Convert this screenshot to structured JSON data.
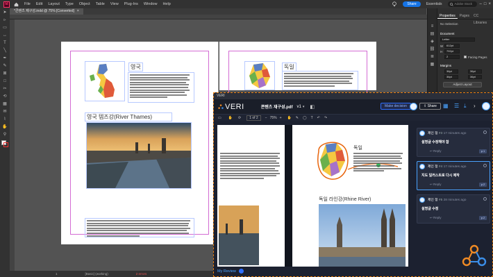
{
  "app": {
    "logo": "Id",
    "menu": [
      "File",
      "Edit",
      "Layout",
      "Type",
      "Object",
      "Table",
      "View",
      "Plug-Ins",
      "Window",
      "Help"
    ],
    "share_label": "Share",
    "workspace": "Essentials",
    "search_placeholder": "Adobe Stock",
    "doc_tab": "*콘텐츠 제구성.indd @ 75% [Converted]",
    "status": {
      "page": "1",
      "master": "[Basic] (working)",
      "errors": "2 errors"
    }
  },
  "right_panel": {
    "tabs": [
      "Properties",
      "Pages",
      "CC Libraries"
    ],
    "no_selection": "No Selection",
    "document_heading": "Document",
    "page_size": "Letter",
    "width": "612pt",
    "height": "792pt",
    "pages": "2",
    "facing_pages": "Facing Pages",
    "margins_heading": "Margins",
    "margin_top": "36pt",
    "margin_bottom": "36pt",
    "margin_left": "36pt",
    "margin_right": "36pt",
    "adjust_layout": "Adjust Layout"
  },
  "indesign_doc": {
    "left_heading_1": "영국",
    "left_heading_2": "영국 템즈강(River Thames)",
    "right_heading_1": "독일"
  },
  "veri": {
    "window_title": "VERI",
    "logo_text": "VERI",
    "file_name": "콘텐츠 재구성.pdf",
    "version": "v1",
    "make_decision": "Make decision",
    "share": "Share",
    "page_indicator": "1 of 2",
    "zoom": "75%",
    "doc_heading_1": "독일",
    "doc_heading_2": "독일 라인강(Rhine River)",
    "my_review": "My Review",
    "comments": [
      {
        "name": "제인 정",
        "num": "#3",
        "time": "17 minutes ago",
        "text": "설명글 수정해야 함",
        "reply": "Reply",
        "badge": "p.1"
      },
      {
        "name": "제인 정",
        "num": "#4",
        "time": "17 minutes ago",
        "text": "지도 일러스트로 다시 제작",
        "reply": "Reply",
        "badge": "p.2"
      },
      {
        "name": "제인 정",
        "num": "#5",
        "time": "28 minutes ago",
        "text": "설명글 수정",
        "reply": "Reply",
        "badge": "p.2"
      }
    ]
  }
}
